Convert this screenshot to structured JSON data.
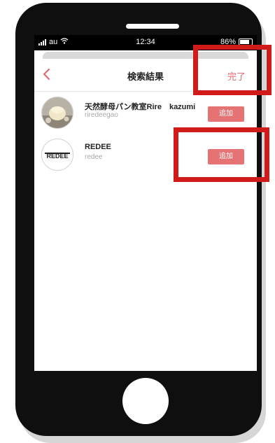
{
  "status_bar": {
    "carrier": "au",
    "time": "12:34",
    "battery": "86%"
  },
  "nav": {
    "title": "検索結果",
    "done_label": "完了",
    "back_icon": "chevron-left-icon"
  },
  "results": [
    {
      "name": "天然酵母パン教室Rire　kazumi",
      "handle": "riredeegao",
      "button_label": "追加"
    },
    {
      "name": "REDEE",
      "handle": "redee",
      "logo_text": "REDEE",
      "button_label": "追加"
    }
  ],
  "colors": {
    "accent": "#e06c74",
    "button": "#e57373",
    "highlight": "#d11a1a"
  }
}
